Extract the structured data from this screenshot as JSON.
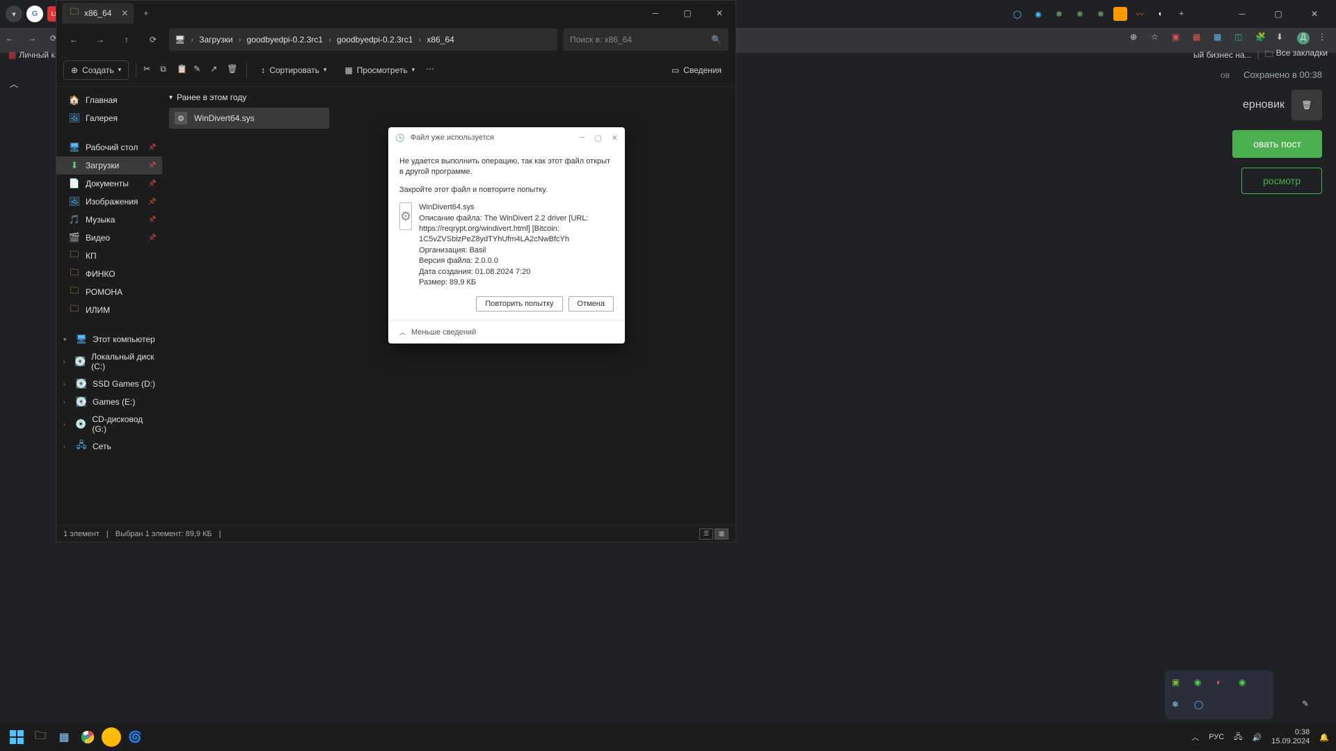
{
  "browser": {
    "bookmarks": {
      "left": "Личный каби",
      "right_text": "ый бизнес на...",
      "all": "Все закладки"
    },
    "content": {
      "saved_label": "Сохранено в 00:38",
      "draft": "ерновик",
      "publish": "овать пост",
      "preview": "росмотр",
      "other_label": "ов"
    }
  },
  "explorer": {
    "tab_title": "x86_64",
    "breadcrumb": [
      "Загрузки",
      "goodbyedpi-0.2.3rc1",
      "goodbyedpi-0.2.3rc1",
      "x86_64"
    ],
    "search_placeholder": "Поиск в: x86_64",
    "toolbar": {
      "create": "Создать",
      "sort": "Сортировать",
      "view": "Просмотреть",
      "details": "Сведения"
    },
    "sidebar": {
      "home": "Главная",
      "gallery": "Галерея",
      "desktop": "Рабочий стол",
      "downloads": "Загрузки",
      "documents": "Документы",
      "pictures": "Изображения",
      "music": "Музыка",
      "video": "Видео",
      "folders": [
        "КП",
        "ФИНКО",
        "РОМОНА",
        "ИЛИМ"
      ],
      "thispc": "Этот компьютер",
      "drives": [
        "Локальный диск (C:)",
        "SSD Games (D:)",
        "Games (E:)",
        "CD-дисковод (G:)"
      ],
      "network": "Сеть"
    },
    "group_header": "Ранее в этом году",
    "file": "WinDivert64.sys",
    "status": {
      "count": "1 элемент",
      "selected": "Выбран 1 элемент: 89,9 КБ"
    }
  },
  "dialog": {
    "title": "Файл уже используется",
    "msg1": "Не удается выполнить операцию, так как этот файл открыт в другой программе.",
    "msg2": "Закройте этот файл и повторите попытку.",
    "file_name": "WinDivert64.sys",
    "line_desc": "Описание файла: The WinDivert 2.2 driver [URL: https://reqrypt.org/windivert.html] [Bitcoin: 1C5vZVSbizPeZ8ydTYhUfm4LA2cNwBfcYh",
    "line_org": "Организация: Basil",
    "line_ver": "Версия файла: 2.0.0.0",
    "line_date": "Дата создания: 01.08.2024 7:20",
    "line_size": "Размер: 89,9 КБ",
    "retry": "Повторить попытку",
    "cancel": "Отмена",
    "less": "Меньше сведений"
  },
  "taskbar": {
    "lang": "РУС",
    "time": "0:38",
    "date": "15.09.2024"
  }
}
